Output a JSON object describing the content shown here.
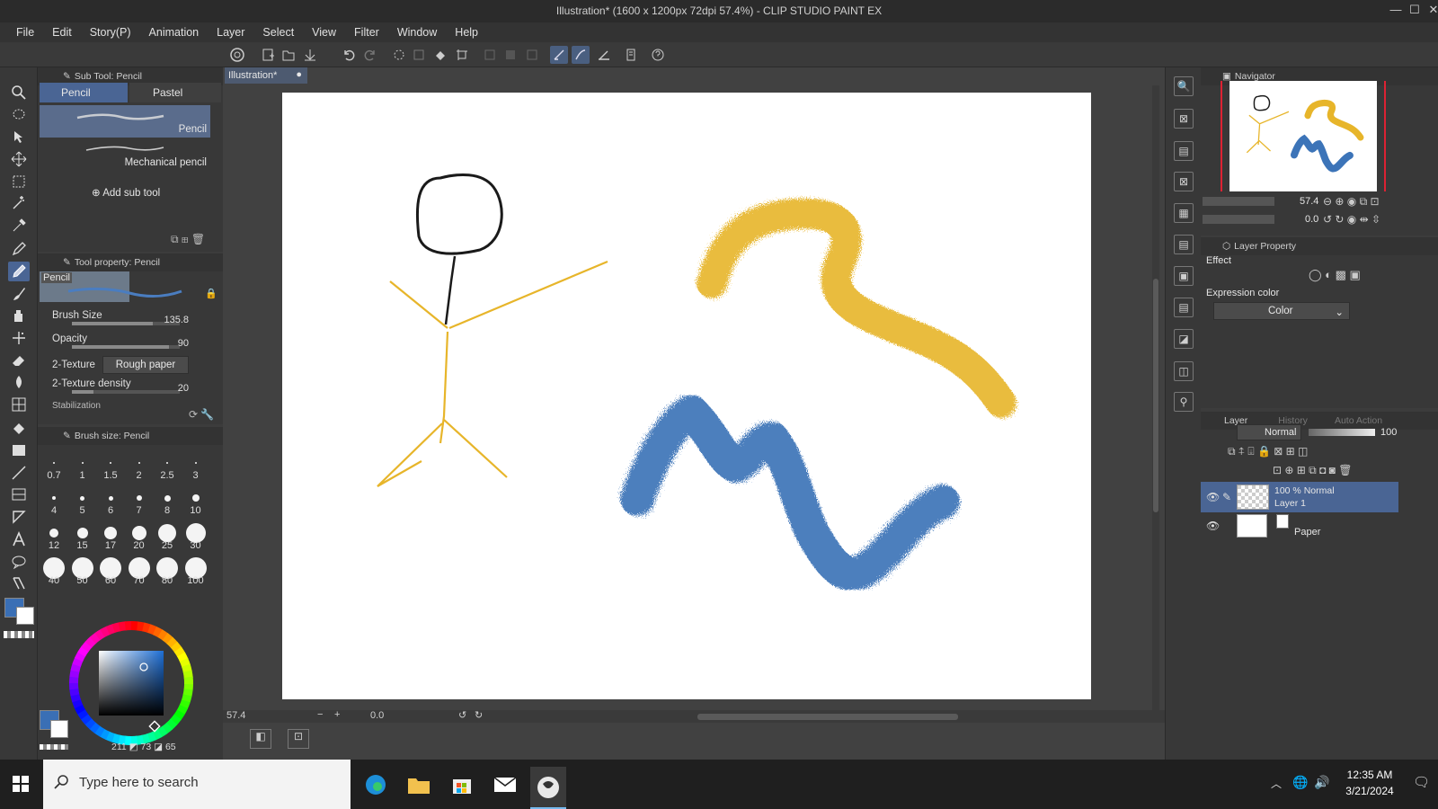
{
  "window": {
    "title": "Illustration* (1600 x 1200px 72dpi 57.4%) - CLIP STUDIO PAINT EX",
    "minimize_glyph": "—",
    "maximize_glyph": "☐",
    "close_glyph": "✕"
  },
  "menu": [
    "File",
    "Edit",
    "Story(P)",
    "Animation",
    "Layer",
    "Select",
    "View",
    "Filter",
    "Window",
    "Help"
  ],
  "sub_tool_panel": {
    "header": "Sub Tool: Pencil",
    "tabs": [
      "Pencil",
      "Pastel"
    ],
    "tools": [
      "Pencil",
      "Mechanical pencil"
    ],
    "add_label": "Add sub tool"
  },
  "tool_property": {
    "header": "Tool property: Pencil",
    "preview_label": "Pencil",
    "brush_size_label": "Brush Size",
    "brush_size_value": "135.8",
    "brush_size_fill": 0.75,
    "opacity_label": "Opacity",
    "opacity_value": "90",
    "opacity_fill": 0.9,
    "texture_label": "2-Texture",
    "texture_value": "Rough paper",
    "texture_density_label": "2-Texture density",
    "texture_density_value": "20",
    "texture_density_fill": 0.2,
    "stabilization_label": "Stabilization"
  },
  "brush_size_panel": {
    "header": "Brush size: Pencil",
    "sizes": [
      "0.7",
      "1",
      "1.5",
      "2",
      "2.5",
      "3",
      "4",
      "5",
      "6",
      "7",
      "8",
      "10",
      "12",
      "15",
      "17",
      "20",
      "25",
      "30",
      "40",
      "50",
      "60",
      "70",
      "80",
      "100"
    ]
  },
  "color_panel": {
    "main_color": "#3a6fb5",
    "sub_color": "#ffffff",
    "hsv_h": "211",
    "hsv_s": "73",
    "hsv_v": "65"
  },
  "document": {
    "tab_label": "Illustration*",
    "zoom": "57.4",
    "rotation": "0.0"
  },
  "navigator": {
    "header": "Navigator",
    "zoom": "57.4",
    "rotation": "0.0"
  },
  "layer_property": {
    "header": "Layer Property",
    "effect_label": "Effect",
    "expression_color_label": "Expression color",
    "expression_color_value": "Color"
  },
  "layer_panel": {
    "tabs": [
      "Layer",
      "History",
      "Auto Action"
    ],
    "blend_mode": "Normal",
    "opacity": "100",
    "layers": [
      {
        "info": "100 % Normal",
        "name": "Layer 1",
        "selected": true
      },
      {
        "info": "",
        "name": "Paper",
        "selected": false
      }
    ]
  },
  "taskbar": {
    "search_placeholder": "Type here to search",
    "time": "12:35 AM",
    "date": "3/21/2024"
  },
  "colors": {
    "stroke_black": "#1a1a1a",
    "stroke_yellow": "#e7b52a",
    "stroke_blue": "#3c74b8",
    "selection": "#4a6594"
  }
}
